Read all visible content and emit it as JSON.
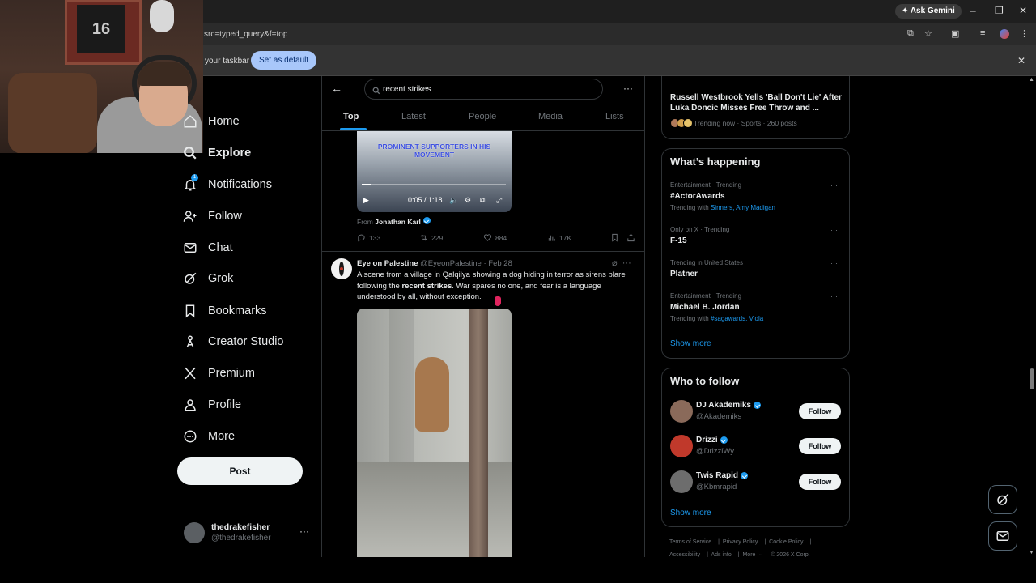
{
  "browser": {
    "url": "src=typed_query&f=top",
    "ask_gemini": "Ask Gemini",
    "infobar_message": "your taskbar",
    "set_default_label": "Set as default"
  },
  "webcam": {
    "jersey_number": "16"
  },
  "nav": {
    "items": [
      {
        "label": "Home",
        "icon": "home-icon"
      },
      {
        "label": "Explore",
        "icon": "search-icon"
      },
      {
        "label": "Notifications",
        "icon": "bell-icon",
        "badge": "1"
      },
      {
        "label": "Follow",
        "icon": "person-add-icon"
      },
      {
        "label": "Chat",
        "icon": "mail-icon"
      },
      {
        "label": "Grok",
        "icon": "grok-icon"
      },
      {
        "label": "Bookmarks",
        "icon": "bookmark-icon"
      },
      {
        "label": "Creator Studio",
        "icon": "creator-icon"
      },
      {
        "label": "Premium",
        "icon": "x-icon"
      },
      {
        "label": "Profile",
        "icon": "profile-icon"
      },
      {
        "label": "More",
        "icon": "more-circle-icon"
      }
    ],
    "post_label": "Post",
    "account": {
      "name": "thedrakefisher",
      "handle": "@thedrakefisher"
    }
  },
  "search": {
    "query": "recent strikes",
    "tabs": [
      "Top",
      "Latest",
      "People",
      "Media",
      "Lists"
    ],
    "active_tab": "Top"
  },
  "tweet1": {
    "video_caption_line1": "PROMINENT SUPPORTERS IN HIS",
    "video_caption_line2": "MOVEMENT",
    "time": "0:05 / 1:18",
    "progress": 0.064,
    "from_prefix": "From",
    "from_name": "Jonathan Karl",
    "replies": "133",
    "reposts": "229",
    "likes": "884",
    "views": "17K"
  },
  "tweet2": {
    "name": "Eye on Palestine",
    "handle": "@EyeonPalestine",
    "date": "Feb 28",
    "text_before": "A scene from a village in Qalqilya showing a dog hiding in terror as sirens blare following the ",
    "text_bold": "recent strikes",
    "text_after": ". War spares no one, and fear is a language understood by all, without exception."
  },
  "right": {
    "news": {
      "title": "Russell Westbrook Yells 'Ball Don't Lie' After Luka Doncic Misses Free Throw and ...",
      "meta": "Trending now · Sports · 260 posts"
    },
    "whats_happening_title": "What’s happening",
    "trends": [
      {
        "context": "Entertainment · Trending",
        "name": "#ActorAwards",
        "with_prefix": "Trending with",
        "with": "Sinners, Amy Madigan"
      },
      {
        "context": "Only on X · Trending",
        "name": "F-15",
        "with_prefix": "",
        "with": ""
      },
      {
        "context": "Trending in United States",
        "name": "Platner",
        "with_prefix": "",
        "with": ""
      },
      {
        "context": "Entertainment · Trending",
        "name": "Michael B. Jordan",
        "with_prefix": "Trending with",
        "with": "#sagawards, Viola"
      }
    ],
    "show_more": "Show more",
    "who_to_follow_title": "Who to follow",
    "follow_label": "Follow",
    "who_to_follow": [
      {
        "name": "DJ Akademiks",
        "handle": "@Akademiks",
        "avatar_color": "#8a6a5a"
      },
      {
        "name": "Drizzi",
        "handle": "@DrizziWy",
        "avatar_color": "#c0392b"
      },
      {
        "name": "Twis Rapid",
        "handle": "@Kbmrapid",
        "avatar_color": "#6d6d6d"
      }
    ],
    "footer": [
      "Terms of Service",
      "Privacy Policy",
      "Cookie Policy",
      "Accessibility",
      "Ads info",
      "More ···",
      "© 2026 X Corp."
    ]
  }
}
